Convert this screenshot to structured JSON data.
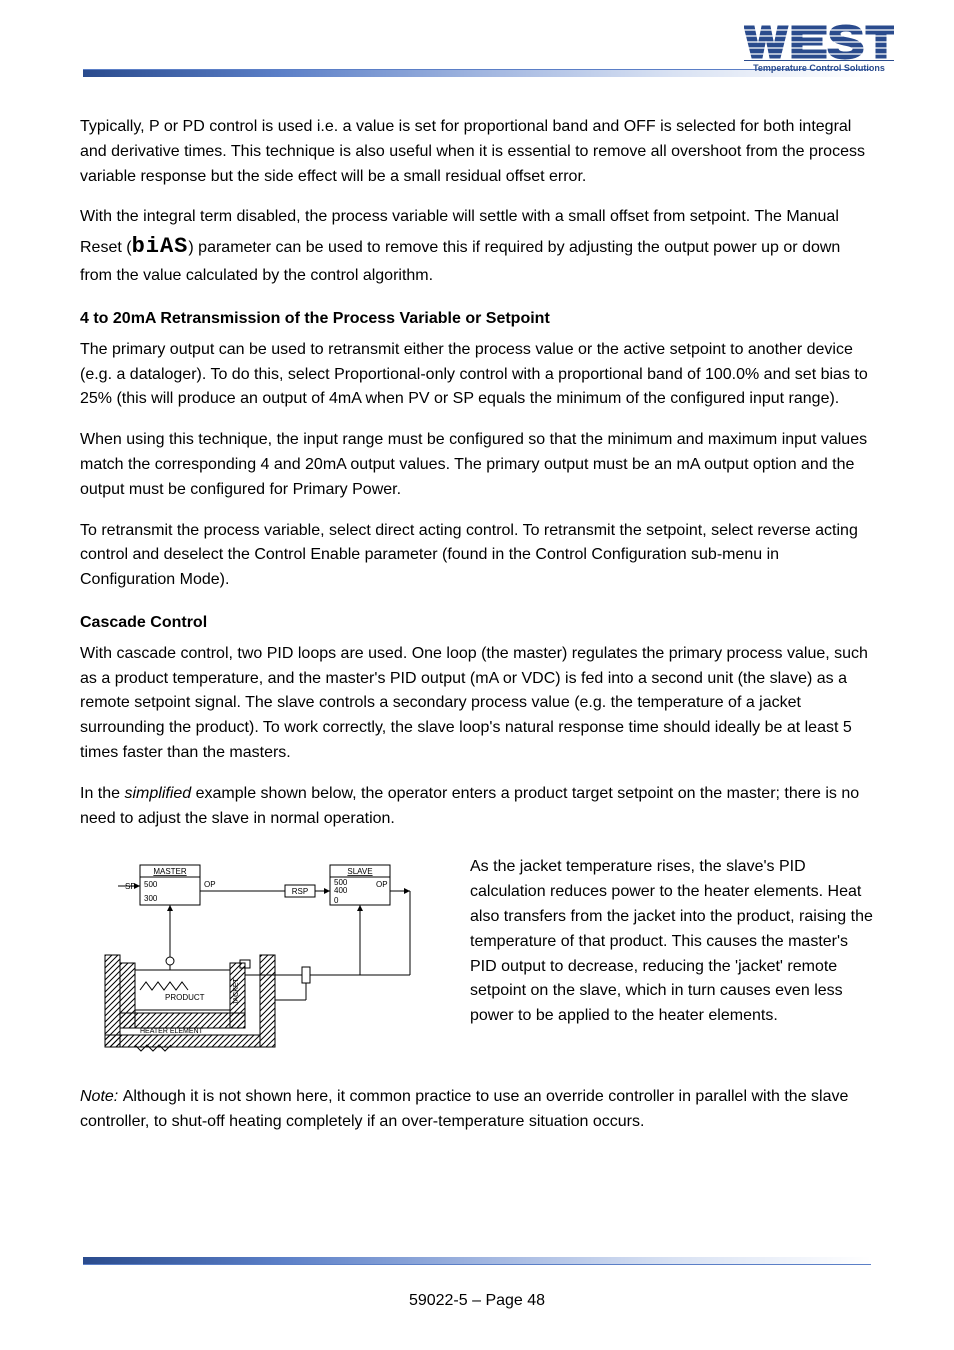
{
  "header": {
    "brand": "WEST",
    "tagline": "Temperature Control Solutions"
  },
  "body": {
    "p1": "Typically, P or PD control is used i.e. a value is set for proportional band and OFF is selected for both integral and derivative times. This technique is also useful when it is essential to remove all overshoot from the process variable response but the side effect will be a small residual offset error.",
    "p2a": "With the integral term disabled, the process variable will settle with a small offset from setpoint. The Manual Reset (",
    "seg": "biAS",
    "p2b": ") parameter can be used to remove this if required by adjusting the output power up or down from the value calculated by the control algorithm.",
    "h1": "4 to 20mA Retransmission of the Process Variable or Setpoint",
    "p3": "The primary output can be used to retransmit either the process value or the active setpoint to another device (e.g. a dataloger). To do this, select Proportional-only control with a proportional band of 100.0% and set bias to 25% (this will produce an output of 4mA when PV or SP equals the minimum of the configured input range).",
    "p4": "When using this technique, the input range must be configured so that the minimum and maximum input values match the corresponding 4 and 20mA output values. The primary output must be an mA output option and the output must be configured for Primary Power.",
    "p5": "To retransmit the process variable, select direct acting control. To retransmit the setpoint, select reverse acting control and deselect the Control Enable parameter (found in the Control Configuration sub-menu in Configuration Mode).",
    "h2": "Cascade Control",
    "p6": "With cascade control, two PID loops are used. One loop (the master) regulates the primary process value, such as a product temperature, and the master's PID output (mA or VDC) is fed into a second unit (the slave) as a remote setpoint signal. The slave controls a secondary process value (e.g. the temperature of a jacket surrounding the product). To work correctly, the slave loop's natural response time should ideally be at least 5 times faster than the masters.",
    "p7a": "In the ",
    "p7em": "simplified",
    "p7b": " example shown below, the operator enters a product target setpoint on the master; there is no need to adjust the slave in normal operation.",
    "side": "As the jacket temperature rises, the slave's PID calculation reduces power to the heater elements. Heat also transfers from the jacket into the product, raising the temperature of that product. This causes the master's PID output to decrease, reducing the 'jacket' remote setpoint on the slave, which in turn causes even less power to be applied to the heater elements.",
    "note1a": "Note: ",
    "note1b": "Although it is not shown here, it common practice to use an override controller in parallel with the slave controller, to shut-off heating completely if an over-temperature situation occurs."
  },
  "diagram": {
    "master": "MASTER",
    "slave": "SLAVE",
    "sp": "SP",
    "op1": "OP",
    "op2": "OP",
    "rsp": "RSP",
    "m_top": "500",
    "m_bot": "300",
    "s_top": "500",
    "s_mid": "400",
    "s_bot": "0",
    "product": "PRODUCT",
    "jacket": "JACKET",
    "heater": "HEATER ELEMENT"
  },
  "footer": {
    "page": "59022-5            –           Page 48"
  }
}
